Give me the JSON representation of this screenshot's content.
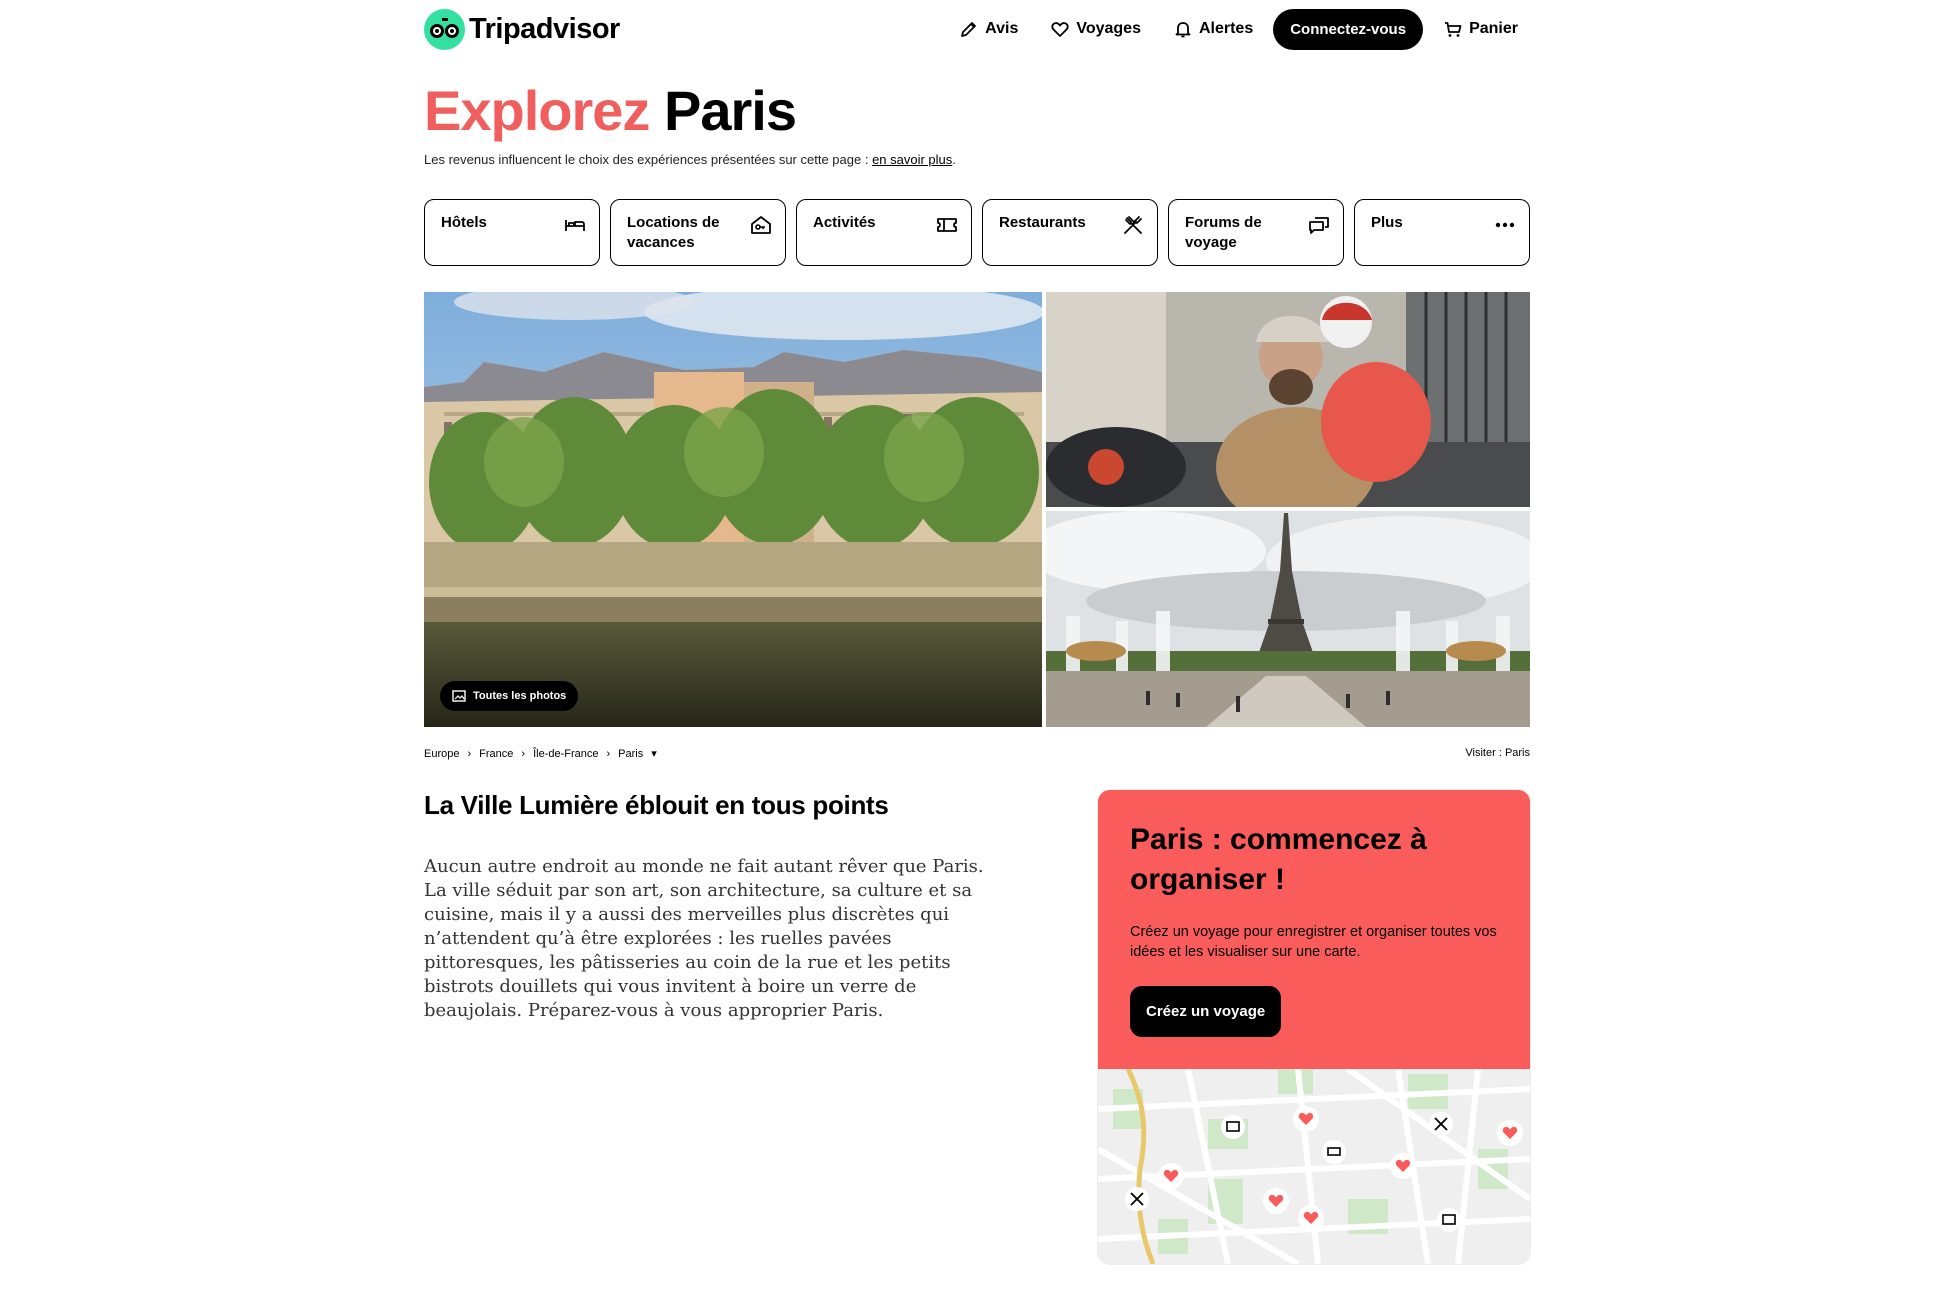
{
  "header": {
    "logo_text": "Tripadvisor",
    "nav": [
      {
        "label": "Avis",
        "icon": "pencil-icon"
      },
      {
        "label": "Voyages",
        "icon": "heart-icon"
      },
      {
        "label": "Alertes",
        "icon": "bell-icon"
      }
    ],
    "signin_label": "Connectez-vous",
    "cart_label": "Panier"
  },
  "hero": {
    "title_accent": "Explorez",
    "title_main": "Paris",
    "disclaimer_text": "Les revenus influencent le choix des expériences présentées sur cette page : ",
    "disclaimer_link": "en savoir plus",
    "disclaimer_end": "."
  },
  "tiles": [
    {
      "label": "Hôtels",
      "icon": "bed-icon"
    },
    {
      "label": "Locations de vacances",
      "icon": "house-key-icon"
    },
    {
      "label": "Activités",
      "icon": "ticket-icon"
    },
    {
      "label": "Restaurants",
      "icon": "fork-knife-icon"
    },
    {
      "label": "Forums de voyage",
      "icon": "chat-bubbles-icon"
    },
    {
      "label": "Plus",
      "icon": "more-dots-icon"
    }
  ],
  "gallery": {
    "all_photos_label": "Toutes les photos"
  },
  "breadcrumbs": {
    "items": [
      "Europe",
      "France",
      "Île-de-France",
      "Paris"
    ],
    "visit": "Visiter : Paris"
  },
  "intro": {
    "title": "La Ville Lumière éblouit en tous points",
    "body": "Aucun autre endroit au monde ne fait autant rêver que Paris. La ville séduit par son art, son architecture, sa culture et sa cuisine, mais il y a aussi des merveilles plus discrètes qui n’attendent qu’à être explorées : les ruelles pavées pittoresques, les pâtisseries au coin de la rue et les petits bistrots douillets qui vous invitent à boire un verre de beaujolais. Préparez-vous à vous approprier Paris."
  },
  "plan_card": {
    "title": "Paris : commencez à organiser !",
    "description": "Créez un voyage pour enregistrer et organiser toutes vos idées et les visualiser sur une carte.",
    "button_label": "Créez un voyage"
  },
  "colors": {
    "accent": "#f05e5e",
    "plan_bg": "#fa5b5b",
    "brand_green": "#34e0a1"
  }
}
